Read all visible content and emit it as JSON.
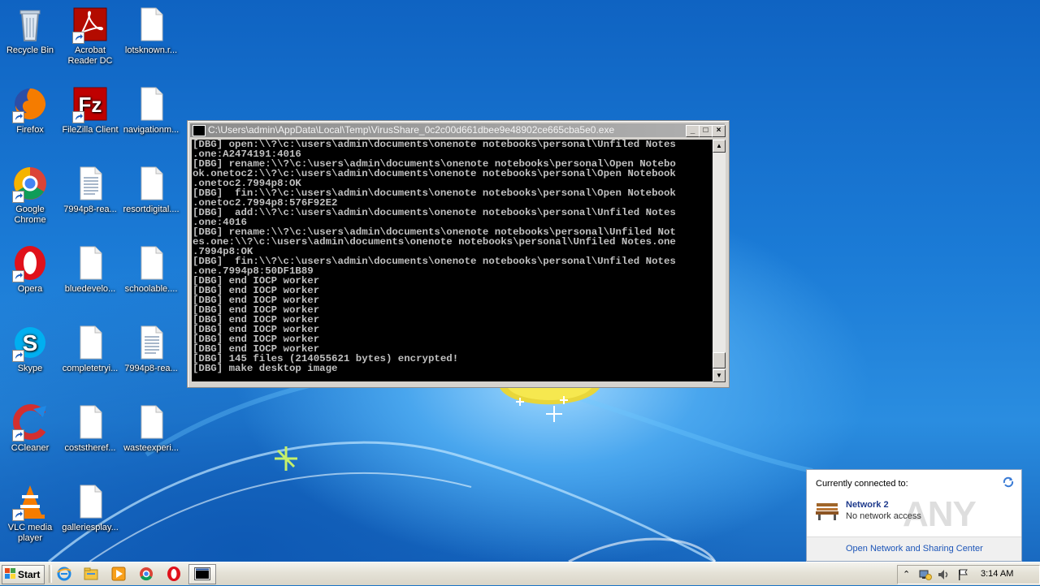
{
  "desktop": {
    "icons": [
      {
        "label": "Recycle Bin",
        "icon": "recycle-bin-icon"
      },
      {
        "label": "Acrobat\nReader DC",
        "icon": "acrobat-reader-icon"
      },
      {
        "label": "lotsknown.r...",
        "icon": "document-icon"
      },
      {
        "label": "Firefox",
        "icon": "firefox-icon"
      },
      {
        "label": "FileZilla Client",
        "icon": "filezilla-icon"
      },
      {
        "label": "navigationm...",
        "icon": "document-icon"
      },
      {
        "label": "Google\nChrome",
        "icon": "chrome-icon"
      },
      {
        "label": "7994p8-rea...",
        "icon": "text-file-icon"
      },
      {
        "label": "resortdigital....",
        "icon": "document-icon"
      },
      {
        "label": "Opera",
        "icon": "opera-icon"
      },
      {
        "label": "bluedevelo...",
        "icon": "document-icon"
      },
      {
        "label": "schoolable....",
        "icon": "document-icon"
      },
      {
        "label": "Skype",
        "icon": "skype-icon"
      },
      {
        "label": "completetryi...",
        "icon": "document-icon"
      },
      {
        "label": "7994p8-rea...",
        "icon": "text-file-icon"
      },
      {
        "label": "CCleaner",
        "icon": "ccleaner-icon"
      },
      {
        "label": "coststheref...",
        "icon": "document-icon"
      },
      {
        "label": "wasteexperi...",
        "icon": "document-icon"
      },
      {
        "label": "VLC media\nplayer",
        "icon": "vlc-icon"
      },
      {
        "label": "galleriesplay...",
        "icon": "document-icon"
      }
    ]
  },
  "console_window": {
    "title": "C:\\Users\\admin\\AppData\\Local\\Temp\\VirusShare_0c2c00d661dbee9e48902ce665cba5e0.exe",
    "minimize": "_",
    "maximize": "□",
    "close": "×",
    "lines": [
      "[DBG] open:\\\\?\\c:\\users\\admin\\documents\\onenote notebooks\\personal\\Unfiled Notes",
      ".one:A2474191:4016",
      "[DBG] rename:\\\\?\\c:\\users\\admin\\documents\\onenote notebooks\\personal\\Open Notebo",
      "ok.onetoc2:\\\\?\\c:\\users\\admin\\documents\\onenote notebooks\\personal\\Open Notebook",
      ".onetoc2.7994p8:OK",
      "[DBG]  fin:\\\\?\\c:\\users\\admin\\documents\\onenote notebooks\\personal\\Open Notebook",
      ".onetoc2.7994p8:576F92E2",
      "[DBG]  add:\\\\?\\c:\\users\\admin\\documents\\onenote notebooks\\personal\\Unfiled Notes",
      ".one:4016",
      "[DBG] rename:\\\\?\\c:\\users\\admin\\documents\\onenote notebooks\\personal\\Unfiled Not",
      "es.one:\\\\?\\c:\\users\\admin\\documents\\onenote notebooks\\personal\\Unfiled Notes.one",
      ".7994p8:OK",
      "[DBG]  fin:\\\\?\\c:\\users\\admin\\documents\\onenote notebooks\\personal\\Unfiled Notes",
      ".one.7994p8:50DF1B89",
      "[DBG] end IOCP worker",
      "[DBG] end IOCP worker",
      "[DBG] end IOCP worker",
      "[DBG] end IOCP worker",
      "[DBG] end IOCP worker",
      "[DBG] end IOCP worker",
      "[DBG] end IOCP worker",
      "[DBG] end IOCP worker",
      "[DBG] 145 files (214055621 bytes) encrypted!",
      "[DBG] make desktop image"
    ]
  },
  "network_popup": {
    "header": "Currently connected to:",
    "network_name": "Network  2",
    "network_status": "No network access",
    "link": "Open Network and Sharing Center",
    "watermark": "ANY RUN"
  },
  "taskbar": {
    "start_label": "Start",
    "clock": "3:14 AM",
    "pinned": [
      "ie-icon",
      "explorer-icon",
      "media-player-icon",
      "chrome-icon",
      "opera-icon"
    ]
  }
}
